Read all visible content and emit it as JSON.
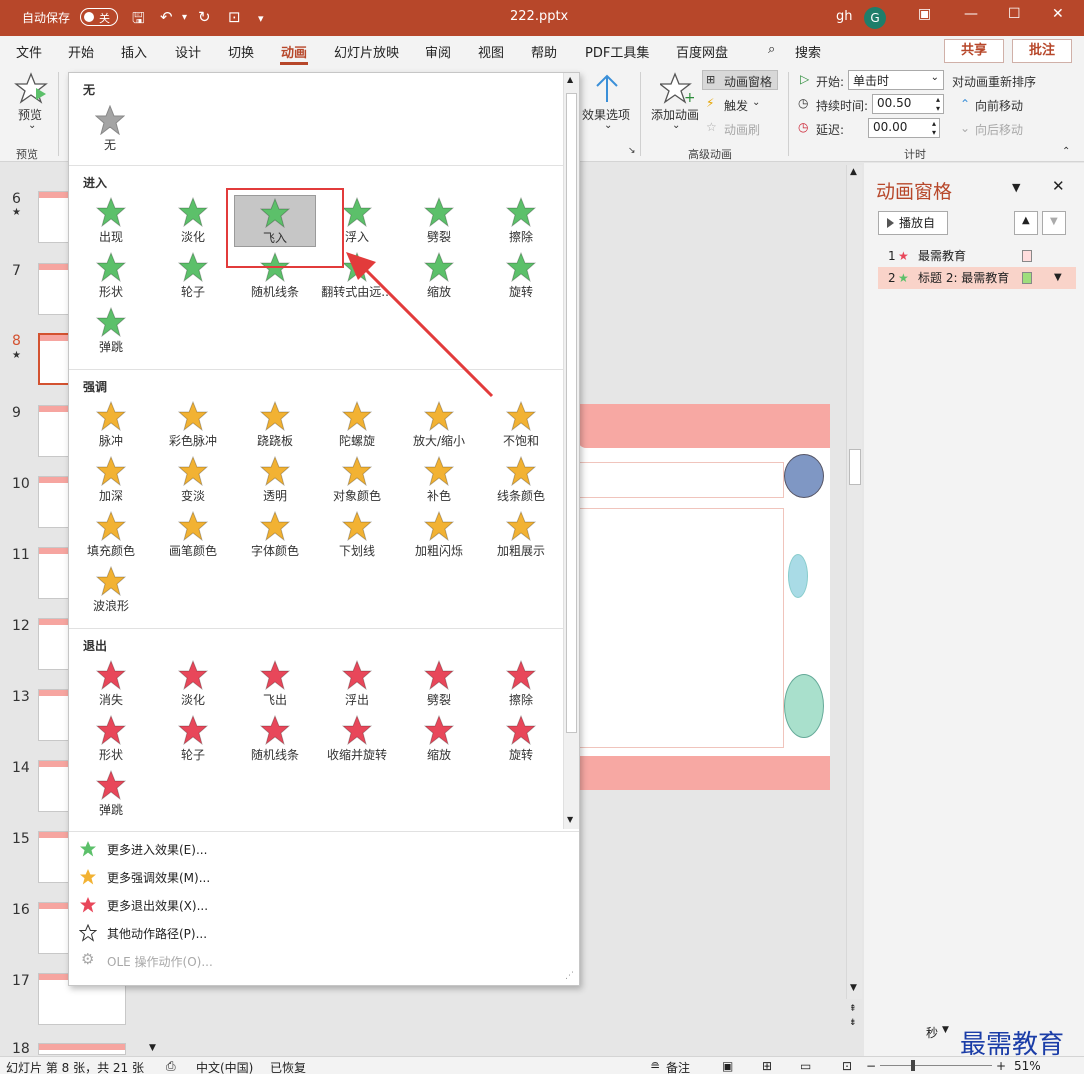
{
  "titlebar": {
    "autosave_label": "自动保存",
    "autosave_state": "关",
    "document_title": "222.pptx",
    "user_name": "gh",
    "user_initial": "G"
  },
  "menu": {
    "items": [
      "文件",
      "开始",
      "插入",
      "设计",
      "切换",
      "动画",
      "幻灯片放映",
      "审阅",
      "视图",
      "帮助",
      "PDF工具集",
      "百度网盘",
      "搜索"
    ],
    "active": "动画",
    "share": "共享",
    "comment": "批注"
  },
  "ribbon": {
    "preview": "预览",
    "preview_group": "预览",
    "effect_options": "效果选项",
    "add_animation": "添加动画",
    "animation_pane": "动画窗格",
    "trigger": "触发",
    "animation_painter": "动画刷",
    "advanced_group": "高级动画",
    "start_label": "开始:",
    "start_value": "单击时",
    "duration_label": "持续时间:",
    "duration_value": "00.50",
    "delay_label": "延迟:",
    "delay_value": "00.00",
    "reorder_title": "对动画重新排序",
    "move_earlier": "向前移动",
    "move_later": "向后移动",
    "timing_group": "计时"
  },
  "thumbnails": {
    "numbers": [
      "6",
      "7",
      "8",
      "9",
      "10",
      "11",
      "12",
      "13",
      "14",
      "15",
      "16",
      "17",
      "18"
    ],
    "selected": "8"
  },
  "gallery": {
    "none_header": "无",
    "none_label": "无",
    "entrance_header": "进入",
    "entrance": [
      "出现",
      "淡化",
      "飞入",
      "浮入",
      "劈裂",
      "擦除",
      "形状",
      "轮子",
      "随机线条",
      "翻转式由远...",
      "缩放",
      "旋转",
      "弹跳"
    ],
    "emphasis_header": "强调",
    "emphasis": [
      "脉冲",
      "彩色脉冲",
      "跷跷板",
      "陀螺旋",
      "放大/缩小",
      "不饱和",
      "加深",
      "变淡",
      "透明",
      "对象颜色",
      "补色",
      "线条颜色",
      "填充颜色",
      "画笔颜色",
      "字体颜色",
      "下划线",
      "加粗闪烁",
      "加粗展示",
      "波浪形"
    ],
    "exit_header": "退出",
    "exit": [
      "消失",
      "淡化",
      "飞出",
      "浮出",
      "劈裂",
      "擦除",
      "形状",
      "轮子",
      "随机线条",
      "收缩并旋转",
      "缩放",
      "旋转",
      "弹跳"
    ],
    "selected_item": "飞入",
    "more_menu": [
      "更多进入效果(E)...",
      "更多强调效果(M)...",
      "更多退出效果(X)...",
      "其他动作路径(P)...",
      "OLE 操作动作(O)..."
    ]
  },
  "anim_pane": {
    "title": "动画窗格",
    "play": "播放自",
    "items": [
      {
        "index": "1",
        "label": "最需教育"
      },
      {
        "index": "2",
        "label": "标题 2: 最需教育"
      }
    ],
    "seconds": "秒"
  },
  "statusbar": {
    "slide_info": "幻灯片 第 8 张，共 21 张",
    "language": "中文(中国)",
    "recovered": "已恢复",
    "notes": "备注",
    "zoom": "51%"
  },
  "watermark": "最需教育",
  "colors": {
    "accent": "#b7472a",
    "entrance_star": "#5cc06a",
    "emphasis_star": "#f2b233",
    "exit_star": "#e8475a"
  }
}
